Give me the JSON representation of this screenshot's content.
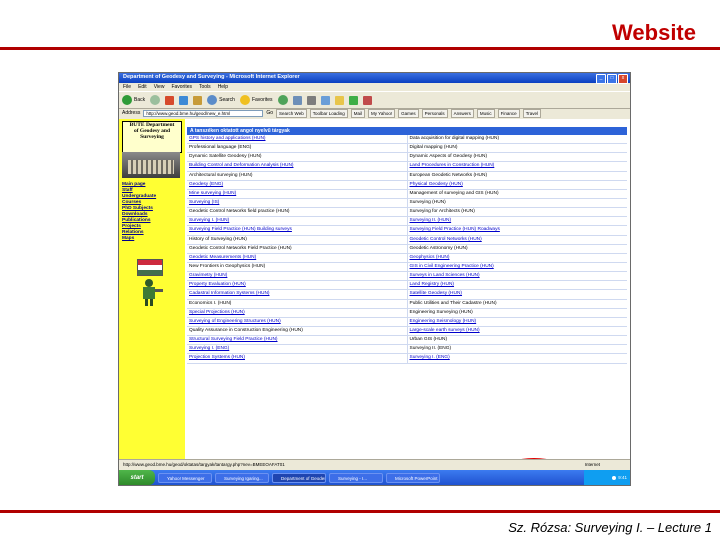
{
  "slide": {
    "title": "Website",
    "footer": "Sz. Rózsa: Surveying I. – Lecture 1"
  },
  "window": {
    "title": "Department of Geodesy and Surveying - Microsoft Internet Explorer",
    "controls": [
      "_",
      "□",
      "x"
    ]
  },
  "menu": [
    "File",
    "Edit",
    "View",
    "Favorites",
    "Tools",
    "Help"
  ],
  "toolbar": {
    "back": "Back",
    "search": "Search",
    "favorites": "Favorites"
  },
  "addressbar": {
    "label": "Address",
    "url": "http://www.geod.bme.hu/geod/new_e.html",
    "go": "Go",
    "links": [
      "Search Web",
      "Toolbar Loading",
      "Mail",
      "My Yahoo!",
      "Games",
      "Personals",
      "Answers",
      "Music",
      "Finance",
      "Travel"
    ]
  },
  "sidebar": {
    "dept_line1": "BUTE Department",
    "dept_line2": "of Geodesy and",
    "dept_line3": "Surveying",
    "nav": [
      "Main page",
      "Staff",
      "Undergraduate",
      "Courses",
      "PhD Subjects",
      "Downloads",
      "Publications",
      "Projects",
      "Relations",
      "Maps"
    ],
    "flag_colors": [
      "#cd2a3e",
      "#ffffff",
      "#436f4d"
    ]
  },
  "table": {
    "header": "A tanszéken oktatott angol nyelvű tárgyak",
    "rows": [
      [
        {
          "t": "GPS history and applications (HUN)",
          "link": true
        },
        {
          "t": "Data acquisition for digital mapping (HUN)",
          "link": false
        }
      ],
      [
        {
          "t": "Professional language (ENG)",
          "link": false
        },
        {
          "t": "Digital mapping (HUN)",
          "link": false
        }
      ],
      [
        {
          "t": "Dynamic Satellite Geodesy (HUN)",
          "link": false
        },
        {
          "t": "Dynamic Aspects of Geodesy (HUN)",
          "link": false
        }
      ],
      [
        {
          "t": "Building Control and Deformation Analysis (HUN)",
          "link": true
        },
        {
          "t": "Land Procedures in Construction (HUN)",
          "link": true
        }
      ],
      [
        {
          "t": "Architectural surveying (HUN)",
          "link": false
        },
        {
          "t": "European Geodetic Networks (HUN)",
          "link": false
        }
      ],
      [
        {
          "t": "Geodesy (ENG)",
          "link": true
        },
        {
          "t": "Physical Geodesy (HUN)",
          "link": true
        }
      ],
      [
        {
          "t": "Mine surveying (HUN)",
          "link": true
        },
        {
          "t": "Management of surveying and GIS (HUN)",
          "link": false
        }
      ],
      [
        {
          "t": "Surveying (IS)",
          "link": true
        },
        {
          "t": "Surveying (HUN)",
          "link": false
        }
      ],
      [
        {
          "t": "Geodetic Control Networks field practice (HUN)",
          "link": false
        },
        {
          "t": "Surveying for Architects (HUN)",
          "link": false
        }
      ],
      [
        {
          "t": "Surveying I. (HUN)",
          "link": true
        },
        {
          "t": "Surveying II. (HUN)",
          "link": true
        }
      ],
      [
        {
          "t": "Surveying Field Practice (HUN) Building surveys",
          "link": true
        },
        {
          "t": "Surveying Field Practice (HUN) Roadways",
          "link": true
        }
      ],
      [
        {
          "t": "History of Surveying (HUN)",
          "link": false
        },
        {
          "t": "Geodetic Control Networks (HUN)",
          "link": true
        }
      ],
      [
        {
          "t": "Geodetic Control Networks Field Practice (HUN)",
          "link": false
        },
        {
          "t": "Geodetic Astronomy (HUN)",
          "link": false
        }
      ],
      [
        {
          "t": "Geodetic Measurements (HUN)",
          "link": true
        },
        {
          "t": "Geophysics (HUN)",
          "link": true
        }
      ],
      [
        {
          "t": "New Frontiers in Geophysics (HUN)",
          "link": false
        },
        {
          "t": "GIS in Civil Engineering Practice (HUN)",
          "link": true
        }
      ],
      [
        {
          "t": "Gravimetry (HUN)",
          "link": true
        },
        {
          "t": "Surveys in Land Sciences (HUN)",
          "link": true
        }
      ],
      [
        {
          "t": "Property Evaluation (HUN)",
          "link": true
        },
        {
          "t": "Land Registry (HUN)",
          "link": true
        }
      ],
      [
        {
          "t": "Cadastral Information Systems (HUN)",
          "link": true
        },
        {
          "t": "Satellite Geodesy (HUN)",
          "link": true
        }
      ],
      [
        {
          "t": "Economics I. (HUN)",
          "link": false
        },
        {
          "t": "Public Utilities and Their Cadastre (HUN)",
          "link": false
        }
      ],
      [
        {
          "t": "Special Projections (HUN)",
          "link": true
        },
        {
          "t": "Engineering Surveying (HUN)",
          "link": false
        }
      ],
      [
        {
          "t": "Surveying of Engineering Structures (HUN)",
          "link": true
        },
        {
          "t": "Engineering Seismology (HUN)",
          "link": true
        }
      ],
      [
        {
          "t": "Quality Assurance in Construction Engineering (HUN)",
          "link": false
        },
        {
          "t": "Large-scale earth surveys (HUN)",
          "link": true
        }
      ],
      [
        {
          "t": "Structural Surveying Field Practice (HUN)",
          "link": true
        },
        {
          "t": "Urban GIS (HUN)",
          "link": false
        }
      ],
      [
        {
          "t": "Surveying I. (ENG)",
          "link": true
        },
        {
          "t": "Surveying II. (ENG)",
          "link": false
        }
      ],
      [
        {
          "t": "Projection Systems (HUN)",
          "link": true
        },
        {
          "t": "Surveying I. (ENG)",
          "link": true
        }
      ]
    ]
  },
  "status": {
    "url": "http://www.geod.bme.hu/geod/oktatas/targyak/tantargy.php?nev=BMEEOAFAT01",
    "zone": "Internet"
  },
  "taskbar": {
    "start": "start",
    "items": [
      "Yahoo! Messenger",
      "Surveying Igaring...",
      "Department of Geodes...",
      "Surveying - I...",
      "Microsoft PowerPoint"
    ],
    "time": "9:41"
  }
}
